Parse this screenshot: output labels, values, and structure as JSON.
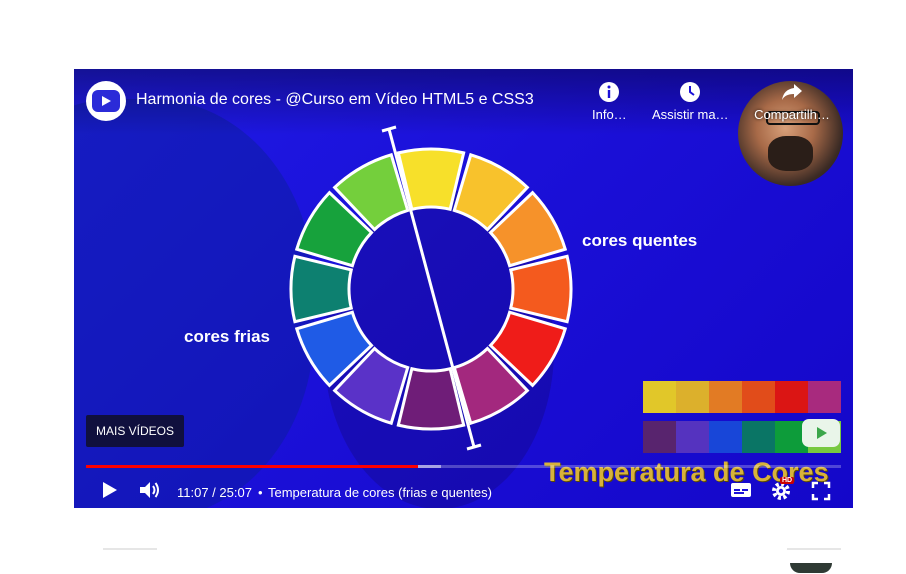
{
  "video": {
    "title": "Harmonia de cores - @Curso em Vídeo HTML5 e CSS3",
    "info_label": "Info…",
    "watch_later_label": "Assistir ma…",
    "share_label": "Compartilh…",
    "more_videos_label": "MAIS VÍDEOS",
    "time_display": "11:07 / 25:07",
    "separator": "•",
    "chapter_title": "Temperatura de cores (frias e quentes)",
    "progress_fraction": 0.44,
    "buffered_fraction": 0.47
  },
  "slide": {
    "warm_label": "cores quentes",
    "cold_label": "cores frias",
    "banner_text": "Temperatura de Cores",
    "wheel_colors": [
      "#f7e02a",
      "#f8c22c",
      "#f6922a",
      "#f45a1e",
      "#ef1c19",
      "#a3287e",
      "#6f1d78",
      "#5a32c8",
      "#1f5be6",
      "#0d8070",
      "#17a23c",
      "#74cf3c"
    ],
    "warm_swatches": [
      "#e1c729",
      "#dcb02c",
      "#e27b24",
      "#e14c1a",
      "#db1514",
      "#a82a7e"
    ],
    "cold_swatches": [
      "#58246e",
      "#5533bf",
      "#1846d8",
      "#0a7565",
      "#0d9c3a",
      "#78c940"
    ]
  },
  "icons": {
    "channel": "play-logo-icon",
    "info": "info-icon",
    "watch_later": "clock-icon",
    "share": "share-icon",
    "play": "play-icon",
    "volume": "volume-icon",
    "subtitles": "subtitles-icon",
    "settings": "gear-icon",
    "fullscreen": "fullscreen-icon"
  },
  "colors": {
    "background": "#1b10d8",
    "progress_played": "#ff0000",
    "banner_text": "#d7b23a"
  }
}
